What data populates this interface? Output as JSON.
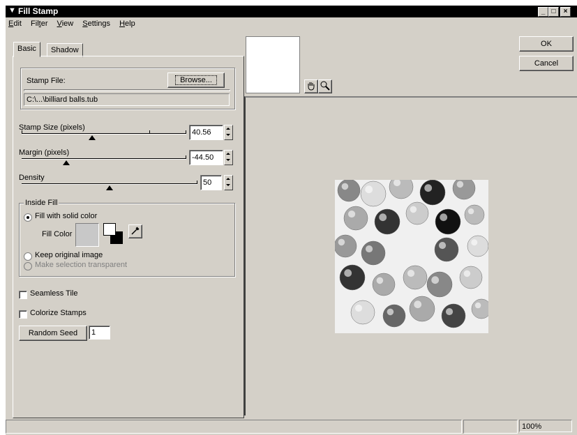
{
  "window": {
    "title": "Fill Stamp"
  },
  "menu": [
    "Edit",
    "Filter",
    "View",
    "Settings",
    "Help"
  ],
  "menu_underline": [
    "E",
    "t",
    "V",
    "S",
    "H"
  ],
  "tabs": {
    "basic": "Basic",
    "shadow": "Shadow"
  },
  "stamp": {
    "label": "Stamp File:",
    "browse": "Browse...",
    "path": "C:\\...\\billiard balls.tub"
  },
  "size": {
    "label": "Stamp Size (pixels)",
    "value": "40.56",
    "fraction": 0.43
  },
  "margin": {
    "label": "Margin (pixels)",
    "value": "-44.50",
    "fraction": 0.27
  },
  "density": {
    "label": "Density",
    "value": "50",
    "fraction": 0.5
  },
  "inside_fill": {
    "title": "Inside Fill",
    "fill_solid": "Fill with solid color",
    "fill_color_label": "Fill Color",
    "keep_original": "Keep original image",
    "make_transparent": "Make selection transparent",
    "fill_color": "#c8c8c8"
  },
  "seamless": "Seamless Tile",
  "colorize": "Colorize Stamps",
  "random_seed": {
    "label": "Random Seed",
    "value": "1"
  },
  "buttons": {
    "ok": "OK",
    "cancel": "Cancel"
  },
  "status": {
    "zoom": "100%"
  },
  "icons": {
    "hand": "hand-pan-icon",
    "zoom": "magnifier-icon",
    "dropper": "eyedropper-icon"
  }
}
